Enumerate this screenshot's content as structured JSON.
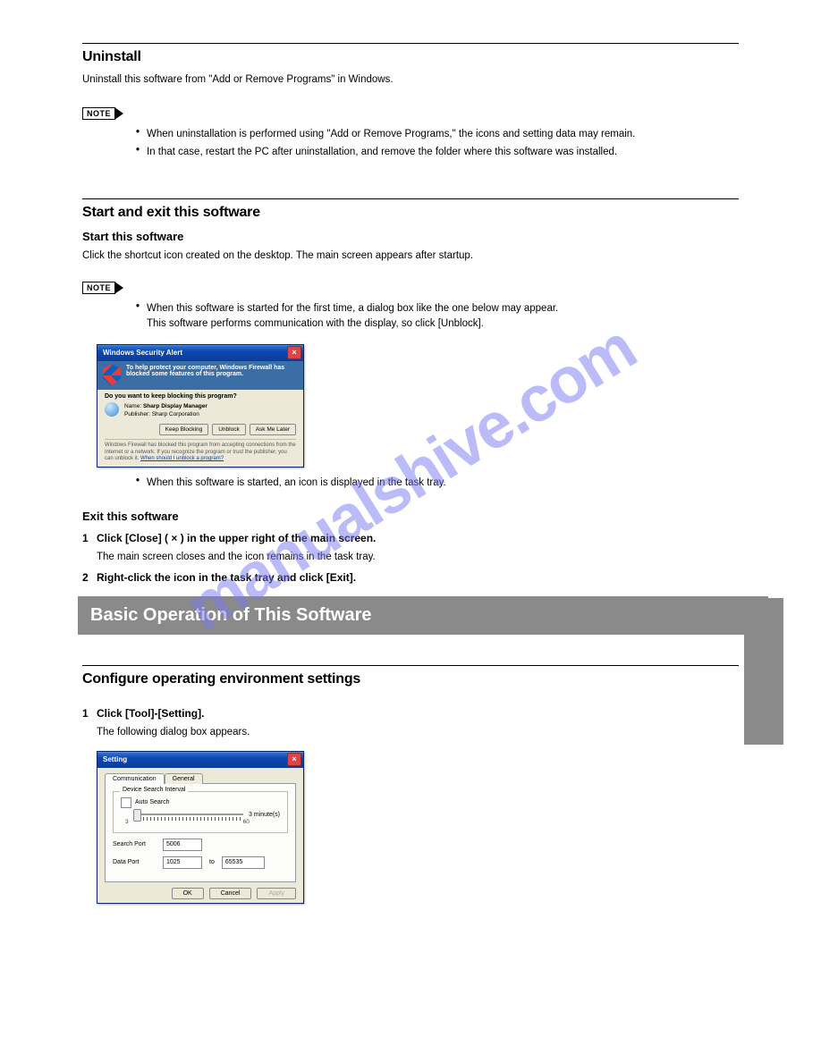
{
  "watermark": "manualshive.com",
  "sec1": {
    "uninstall_title": "Uninstall",
    "uninstall_intro": "Uninstall this software from \"Add or Remove Programs\" in Windows.",
    "uninstall_note_bullets": [
      "When uninstallation is performed using \"Add or Remove Programs,\" the icons and setting data may remain.",
      "In that case, restart the PC after uninstallation, and remove the folder where this software was installed."
    ]
  },
  "sec2": {
    "start_title": "Start and exit this software",
    "start_h": "Start this software",
    "start_text": "Click the shortcut icon created on the desktop. The main screen appears after startup.",
    "start_note_a": "When this software is started for the first time, a dialog box like the one below may appear.",
    "start_note_a2": "This software performs communication with the display, so click [Unblock].",
    "start_note_b": "When this software is started, an icon is displayed in the task tray."
  },
  "alert": {
    "title": "Windows Security Alert",
    "header": "To help protect your computer, Windows Firewall has blocked some features of this program.",
    "question": "Do you want to keep blocking this program?",
    "name_l": "Name:",
    "name_v": "Sharp Display Manager",
    "pub_l": "Publisher:",
    "pub_v": "Sharp Corporation",
    "btn_keep": "Keep Blocking",
    "btn_unblock": "Unblock",
    "btn_ask": "Ask Me Later",
    "foot1": "Windows Firewall has blocked this program from accepting connections from the Internet or a network. If you recognize the program or trust the publisher, you can unblock it.",
    "foot2": "When should I unblock a program?"
  },
  "exit": {
    "h": "Exit this software",
    "steps": {
      "s1": "Click [Close] ( × ) in the upper right of the main screen.",
      "s1_sub": "The main screen closes and the icon remains in the task tray.",
      "s2": "Right-click the icon in the task tray and click [Exit].",
      "num1": "1",
      "num2": "2"
    }
  },
  "gray_bar": "Basic Operation of This Software",
  "sec3": {
    "cfg_title": "Configure operating environment settings",
    "cfg_click": "Click [Tool]-[Setting].",
    "cfg_appear": "The following dialog box appears.",
    "num1": "1"
  },
  "setting": {
    "title": "Setting",
    "tabs": {
      "comm": "Communication",
      "gen": "General"
    },
    "legend": "Device Search Interval",
    "auto": "Auto Search",
    "slider_unit": "3  minute(s)",
    "slider_min": "3",
    "slider_max": "60",
    "search_port_l": "Search Port",
    "search_port_v": "5006",
    "data_port_l": "Data Port",
    "data_port_from": "1025",
    "to": "to",
    "data_port_to": "65535",
    "ok": "OK",
    "cancel": "Cancel",
    "apply": "Apply"
  },
  "note_label": "NOTE"
}
